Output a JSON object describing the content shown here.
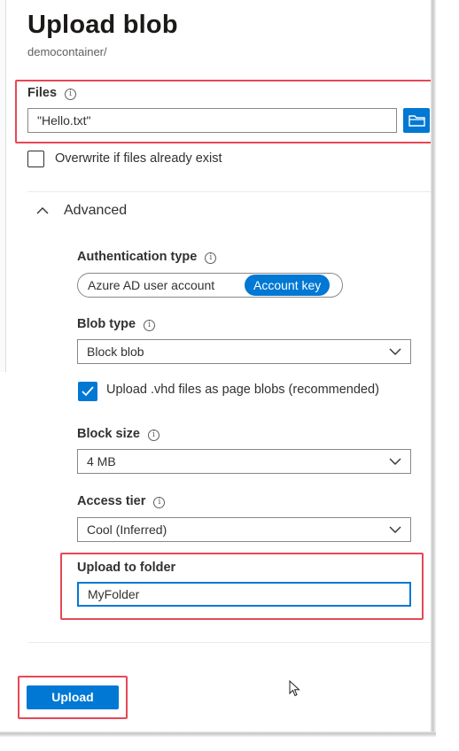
{
  "panel": {
    "title": "Upload blob",
    "subtitle": "democontainer/"
  },
  "files": {
    "label": "Files",
    "value": "\"Hello.txt\""
  },
  "overwrite": {
    "label": "Overwrite if files already exist",
    "checked": false
  },
  "advanced": {
    "label": "Advanced",
    "expanded": true
  },
  "auth": {
    "label": "Authentication type",
    "options": [
      "Azure AD user account",
      "Account key"
    ],
    "selected": "Account key"
  },
  "blob_type": {
    "label": "Blob type",
    "value": "Block blob"
  },
  "vhd": {
    "label": "Upload .vhd files as page blobs (recommended)",
    "checked": true
  },
  "block_size": {
    "label": "Block size",
    "value": "4 MB"
  },
  "access_tier": {
    "label": "Access tier",
    "value": "Cool (Inferred)"
  },
  "folder": {
    "label": "Upload to folder",
    "value": "MyFolder"
  },
  "actions": {
    "upload_label": "Upload"
  },
  "colors": {
    "accent": "#0078d4",
    "highlight": "#e74856"
  },
  "icons": [
    "info-icon",
    "folder-icon",
    "chevron-up-icon",
    "chevron-down-icon",
    "checkmark-icon",
    "mouse-cursor-icon"
  ]
}
